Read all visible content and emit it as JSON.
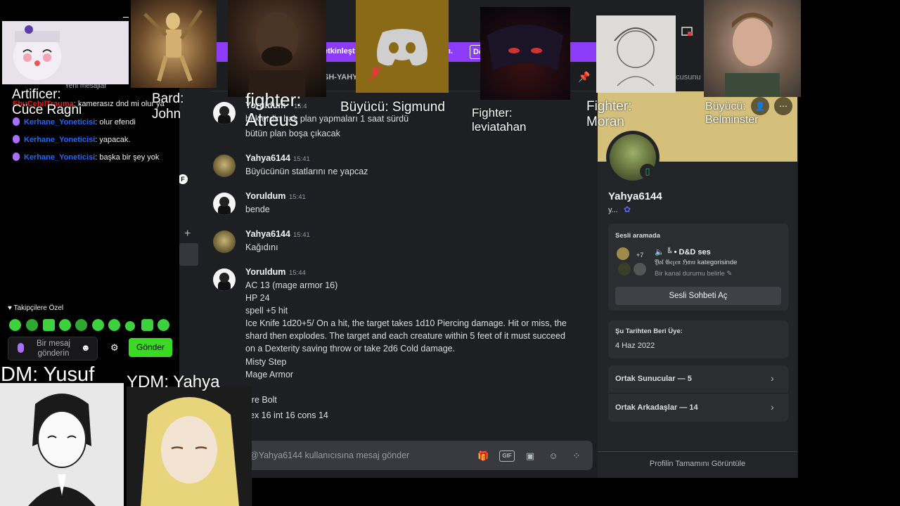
{
  "banner": {
    "text_left": "etkinleşt",
    "text_right": "ıldı.",
    "button": "De"
  },
  "header": {
    "channel_name": "SH-YAHY",
    "search": "ucusunu"
  },
  "sidebar": {
    "plus": "+"
  },
  "messages": [
    {
      "user": "Yoruldum",
      "time": "15:4",
      "lines": [
        "beklerdin bak plan yapmaları 1 saat sürdü",
        "bütün plan boşa çıkacak"
      ]
    },
    {
      "user": "Yahya6144",
      "time": "15:41",
      "lines": [
        "Büyücünün statlarını ne yapcaz"
      ]
    },
    {
      "user": "Yoruldum",
      "time": "15:41",
      "lines": [
        "bende"
      ]
    },
    {
      "user": "Yahya6144",
      "time": "15:41",
      "lines": [
        "Kağıdını"
      ]
    },
    {
      "user": "Yoruldum",
      "time": "15:44",
      "lines": [
        "AC 13 (mage armor 16)",
        "HP 24",
        "spell +5 hit",
        "Ice Knife 1d20+5/ On a hit, the target takes 1d10 Piercing damage. Hit or miss, the",
        "shard then explodes. The target and each creature within 5 feet of it must succeed",
        "on a Dexterity saving throw or take 2d6 Cold damage.",
        "Misty Step",
        "Mage Armor",
        "",
        "ire Bolt",
        "ex 16 int 16 cons 14"
      ]
    }
  ],
  "input": {
    "placeholder": "@Yahya6144 kullanıcısına mesaj gönder",
    "icons": [
      "gift-icon",
      "gif-icon",
      "sticker-icon",
      "emoji-icon",
      "apps-icon"
    ],
    "gif": "GIF"
  },
  "profile": {
    "name": "Yahya6144",
    "subtitle": "y...",
    "voice": {
      "title": "Sesli aramada",
      "count": "+7",
      "channel": "🔈 ╚ • D&D ses",
      "category": "𝔜𝔬𝔩 𝔊𝔢𝔠̧𝔢𝔫 ℌ𝔞𝔫ı kategorisinde",
      "status": "Bir kanal durumu belirle ✎",
      "button": "Sesli Sohbeti Aç"
    },
    "member_since_title": "Şu Tarihten Beri Üye:",
    "member_since": "4 Haz 2022",
    "mutual_servers": "Ortak Sunucular — 5",
    "mutual_friends": "Ortak Arkadaşlar — 14",
    "footer": "Profilin Tamamını Görüntüle"
  },
  "twitch_chat": {
    "header_partial": "Yeni mesajlar",
    "lines": [
      {
        "user": "EbuCehilTrauma",
        "text": ": kamerasız dnd mi olur ya",
        "color": "#e91916"
      },
      {
        "user": "Kerhane_Yoneticisi",
        "text": ": olur efendi",
        "color": "#1e69ff"
      },
      {
        "user": "Kerhane_Yoneticisi",
        "text": ": yapacak.",
        "color": "#1e69ff"
      },
      {
        "user": "Kerhane_Yoneticisi",
        "text": ": başka bir şey yok",
        "color": "#1e69ff"
      }
    ],
    "followers_label": "Takipçilere Özel",
    "input_placeholder_1": "Bir mesaj",
    "input_placeholder_2": "gönderin",
    "send": "Gönder",
    "accent": "#3bd826"
  },
  "cams": {
    "artificer": {
      "role": "Artificer:",
      "name": "Cüce Ragni"
    },
    "bard": {
      "role": "Bard:",
      "name": "John"
    },
    "fighter_atreus": {
      "role": "fighter:",
      "name": "Atreus"
    },
    "buyucu_sigmund": {
      "label": "Büyücü: Sigmund"
    },
    "fighter_leviatahan": {
      "role": "Fighter:",
      "name": "leviatahan"
    },
    "fighter_moran": {
      "role": "Fighter:",
      "name": "Moran"
    },
    "buyucu_belminster": {
      "role": "Büyücü:",
      "name": "Belminster"
    },
    "dm": {
      "label": "DM: Yusuf"
    },
    "ydm": {
      "label": "YDM: Yahya"
    }
  },
  "colors": {
    "discord_bg": "#1e1f22",
    "banner": "#8c3cf6",
    "profile_banner": "#d4c07a",
    "twitch_send": "#3bd826"
  }
}
